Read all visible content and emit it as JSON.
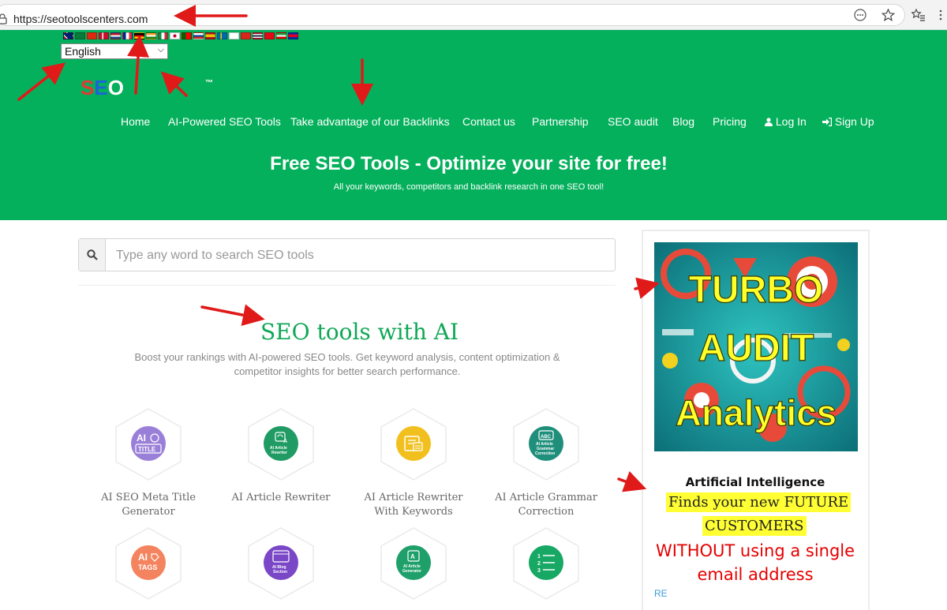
{
  "browser": {
    "url": "https://seotoolscenters.com",
    "icons": [
      "lock-icon",
      "more-icon",
      "favorite-star-icon",
      "favorites-list-icon"
    ]
  },
  "header": {
    "language_selected": "English",
    "logo_text": [
      "S",
      "E",
      "O"
    ],
    "trademark": "™",
    "nav": [
      "Home",
      "AI-Powered SEO Tools",
      "Take advantage of our Backlinks",
      "Contact us",
      "Partnership",
      "SEO audit",
      "Blog",
      "Pricing",
      "Log In",
      "Sign Up"
    ],
    "hero_title": "Free SEO Tools - Optimize your site for free!",
    "hero_subtitle": "All your keywords, competitors and backlink research in one SEO tool!"
  },
  "search": {
    "placeholder": "Type any word to search SEO tools"
  },
  "main": {
    "section_title": "SEO tools with AI",
    "section_description_line1": "Boost your rankings with AI-powered SEO tools. Get keyword analysis, content optimization &",
    "section_description_line2": "competitor insights for better search performance.",
    "tools_row1": [
      {
        "line1": "AI SEO Meta Title",
        "line2": "Generator",
        "icon_text": "AI TITLE",
        "color": "#9a7fd8"
      },
      {
        "line1": "AI Article Rewriter",
        "line2": "",
        "icon_text": "AI Article Rewriter",
        "color": "#1f9b63"
      },
      {
        "line1": "AI Article Rewriter",
        "line2": "With Keywords",
        "icon_text": "",
        "color": "#f2c01e"
      },
      {
        "line1": "AI Article Grammar",
        "line2": "Correction",
        "icon_text": "ABC AI Article Grammar Correction",
        "color": "#1f8f7b"
      }
    ],
    "tools_row2": [
      {
        "icon_text": "AI TAGS",
        "color": "#f4845f"
      },
      {
        "icon_text": "AI Blog Section",
        "color": "#7a47c7"
      },
      {
        "icon_text": "AI Article Generator",
        "color": "#1fa06a"
      },
      {
        "icon_text": "1 2 3",
        "color": "#16a864"
      }
    ]
  },
  "sidebar": {
    "ad_image_lines": [
      "TURBO",
      "AUDIT",
      "Analytics"
    ],
    "ai_heading": "Artificial Intelligence",
    "highlight_line1": "Finds your new FUTURE",
    "highlight_line2": "CUSTOMERS",
    "red_line1": "WITHOUT using a single",
    "red_line2": "email address",
    "link_fragment": "RE"
  },
  "colors": {
    "header_green": "#05b05c",
    "title_green": "#0fa856",
    "annotation_red": "#e01919"
  }
}
